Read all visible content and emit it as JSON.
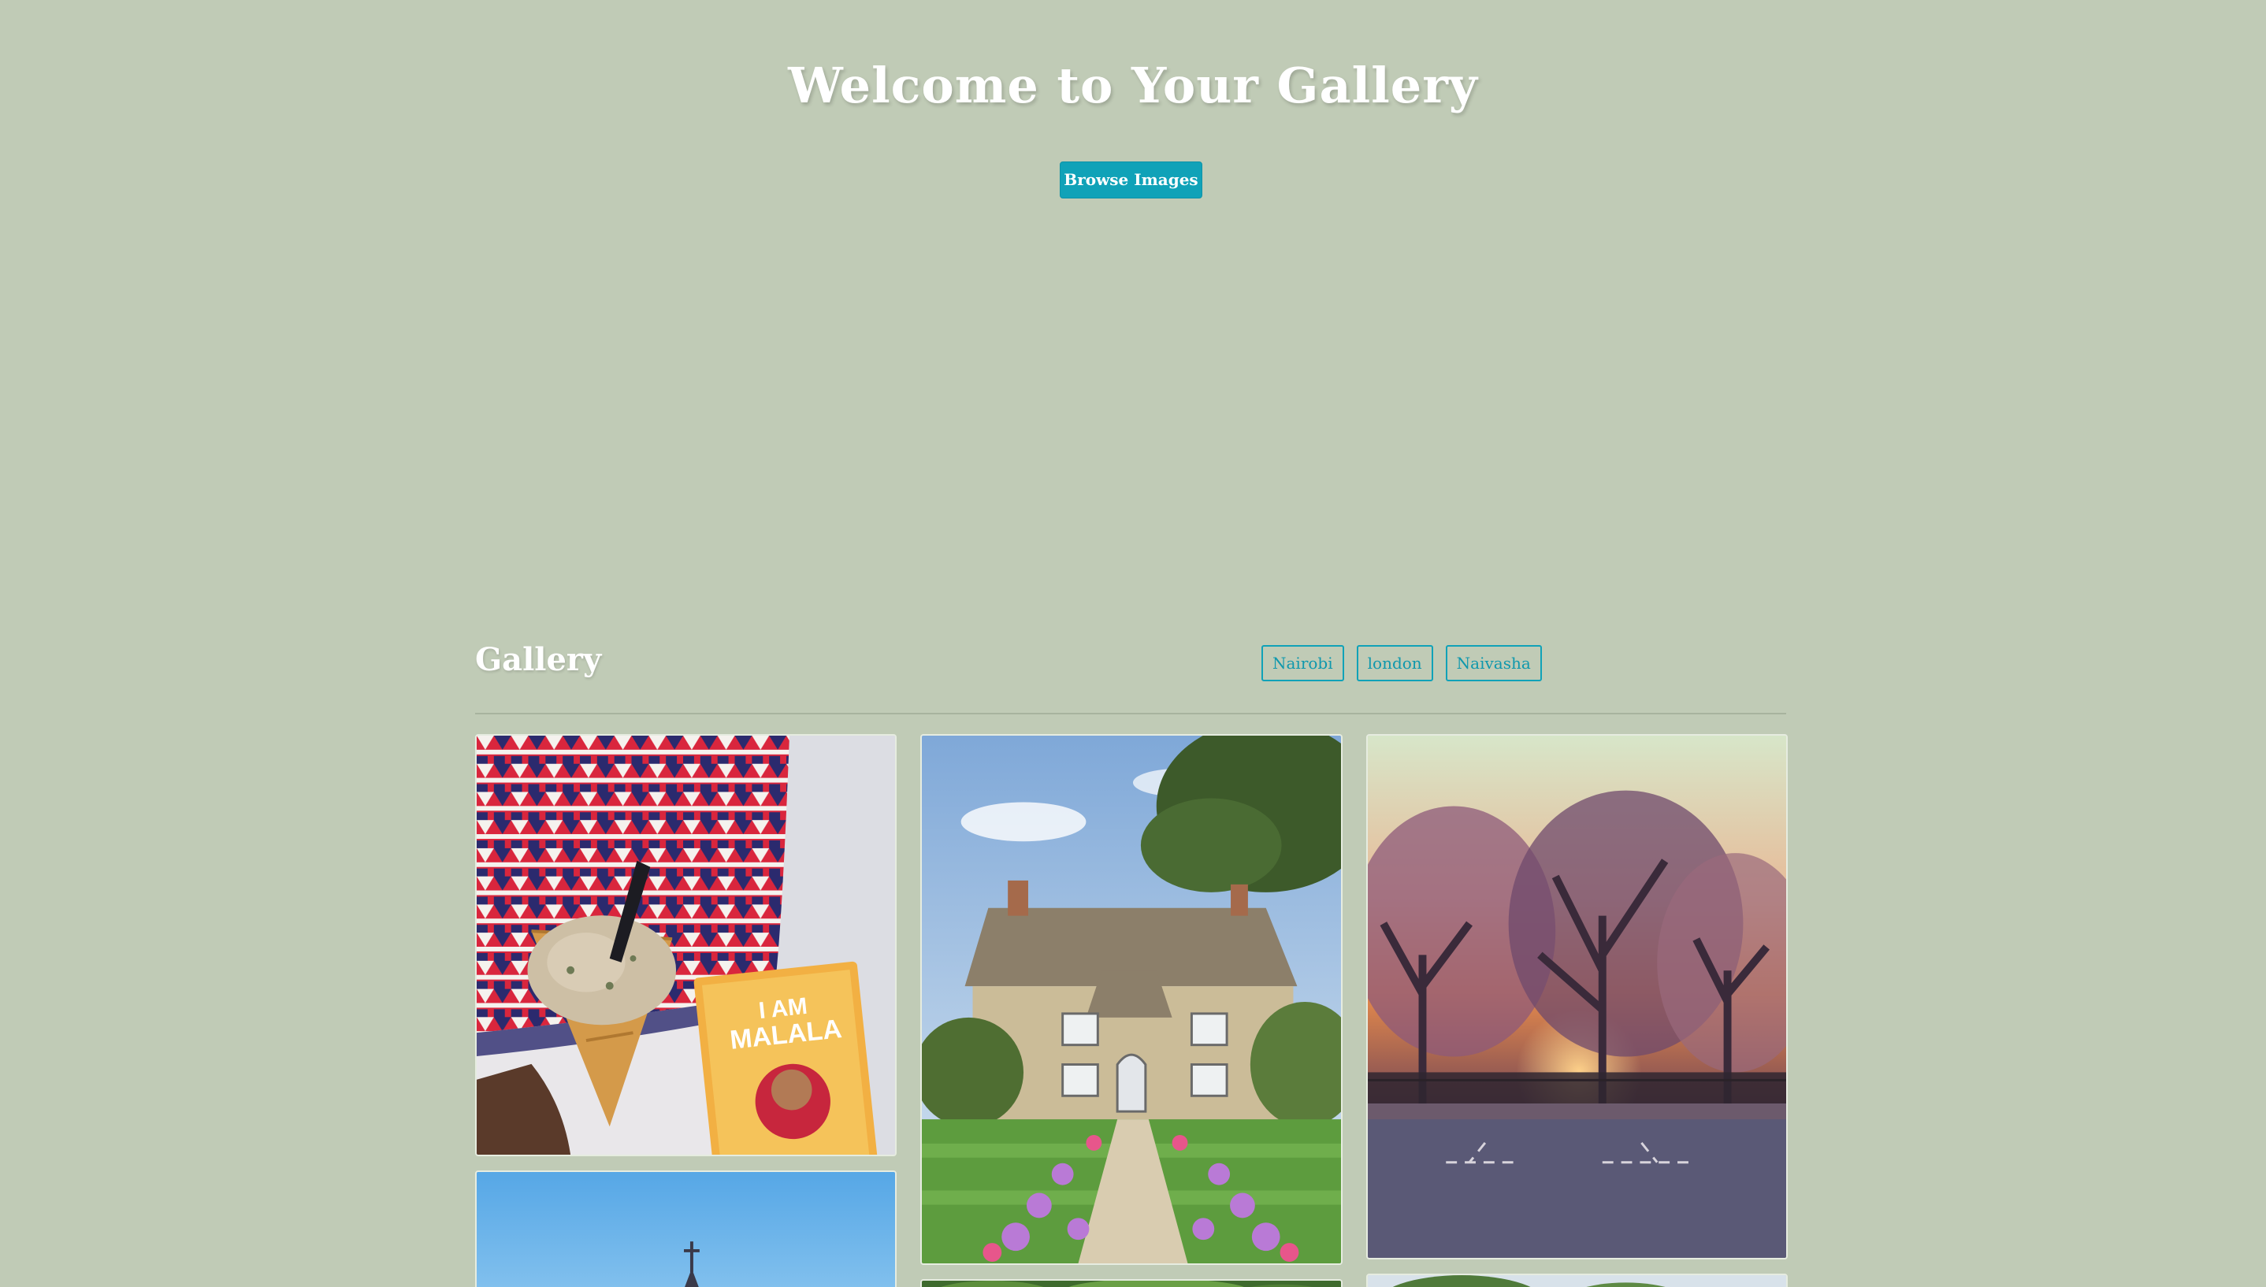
{
  "hero": {
    "title": "Welcome to Your Gallery",
    "browse_button": "Browse Images"
  },
  "gallery": {
    "title": "Gallery",
    "filters": [
      "Nairobi",
      "london",
      "Naivasha"
    ]
  },
  "colors": {
    "background": "#c0cbb6",
    "accent": "#10a2b8",
    "text": "#ffffff"
  },
  "photos": [
    {
      "name": "photo-ice-cream-book"
    },
    {
      "name": "photo-cottage-garden"
    },
    {
      "name": "photo-sunset-trees"
    },
    {
      "name": "photo-church-sky"
    },
    {
      "name": "photo-foliage"
    },
    {
      "name": "photo-trees-sky"
    }
  ]
}
